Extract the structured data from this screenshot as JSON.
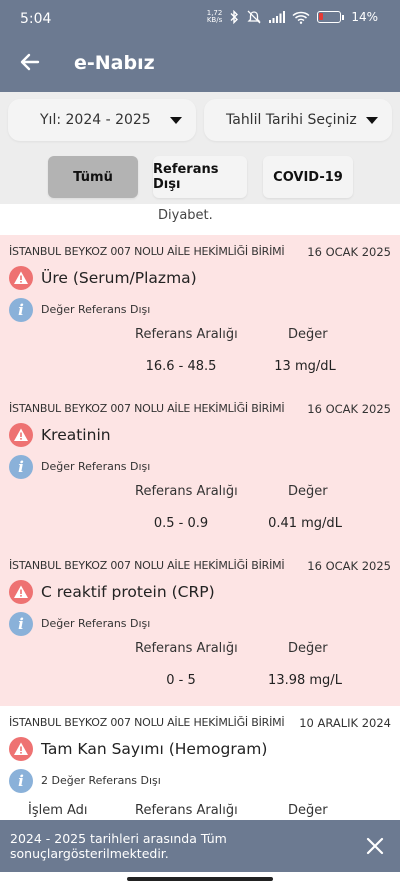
{
  "status_bar": {
    "time": "5:04",
    "net_speed_value": "1,72",
    "net_speed_unit": "KB/s",
    "battery": "14%",
    "icons": [
      "bluetooth-icon",
      "mute-icon",
      "signal-icon",
      "wifi-icon",
      "battery-icon"
    ]
  },
  "app_bar": {
    "title": "e-Nabız",
    "back_icon": "arrow-left-icon"
  },
  "filters": {
    "year_dropdown": "Yıl: 2024 - 2025",
    "date_dropdown": "Tahlil Tarihi Seçiniz",
    "chips": [
      {
        "label": "Tümü",
        "selected": true
      },
      {
        "label": "Referans Dışı",
        "selected": false
      },
      {
        "label": "COVID-19",
        "selected": false
      }
    ]
  },
  "list": {
    "cut_off_text": "Diyabet.",
    "cards": [
      {
        "clinic": "İSTANBUL BEYKOZ 007 NOLU AİLE HEKİMLİĞİ BİRİMİ",
        "date": "16 OCAK 2025",
        "test_name": "Üre (Serum/Plazma)",
        "ref_note": "Değer Referans Dışı",
        "header_name": "",
        "header_range": "Referans Aralığı",
        "header_value": "Değer",
        "range": "16.6 - 48.5",
        "value": "13 mg/dL",
        "out_of_range": true
      },
      {
        "clinic": "İSTANBUL BEYKOZ 007 NOLU AİLE HEKİMLİĞİ BİRİMİ",
        "date": "16 OCAK 2025",
        "test_name": "Kreatinin",
        "ref_note": "Değer Referans Dışı",
        "header_name": "",
        "header_range": "Referans Aralığı",
        "header_value": "Değer",
        "range": "0.5 - 0.9",
        "value": "0.41 mg/dL",
        "out_of_range": true
      },
      {
        "clinic": "İSTANBUL BEYKOZ 007 NOLU AİLE HEKİMLİĞİ BİRİMİ",
        "date": "16 OCAK 2025",
        "test_name": "C reaktif protein (CRP)",
        "ref_note": "Değer Referans Dışı",
        "header_name": "",
        "header_range": "Referans Aralığı",
        "header_value": "Değer",
        "range": "0 - 5",
        "value": "13.98 mg/L",
        "out_of_range": true
      },
      {
        "clinic": "İSTANBUL BEYKOZ 007 NOLU AİLE HEKİMLİĞİ BİRİMİ",
        "date": "10 ARALIK 2024",
        "test_name": "Tam Kan Sayımı (Hemogram)",
        "ref_note": "2 Değer Referans Dışı",
        "header_name": "İşlem Adı",
        "header_range": "Referans Aralığı",
        "header_value": "Değer",
        "range": "",
        "value": "",
        "out_of_range": false
      }
    ]
  },
  "snackbar": {
    "message": "2024 - 2025 tarihleri arasında Tüm sonuçlargösterilmektedir.",
    "close_icon": "close-icon"
  },
  "colors": {
    "primary": "#6c7a91",
    "pink_card": "#fde4e4",
    "warning": "#ee7272",
    "info": "#8ab1d9",
    "selected_chip": "#b3b3b3"
  }
}
